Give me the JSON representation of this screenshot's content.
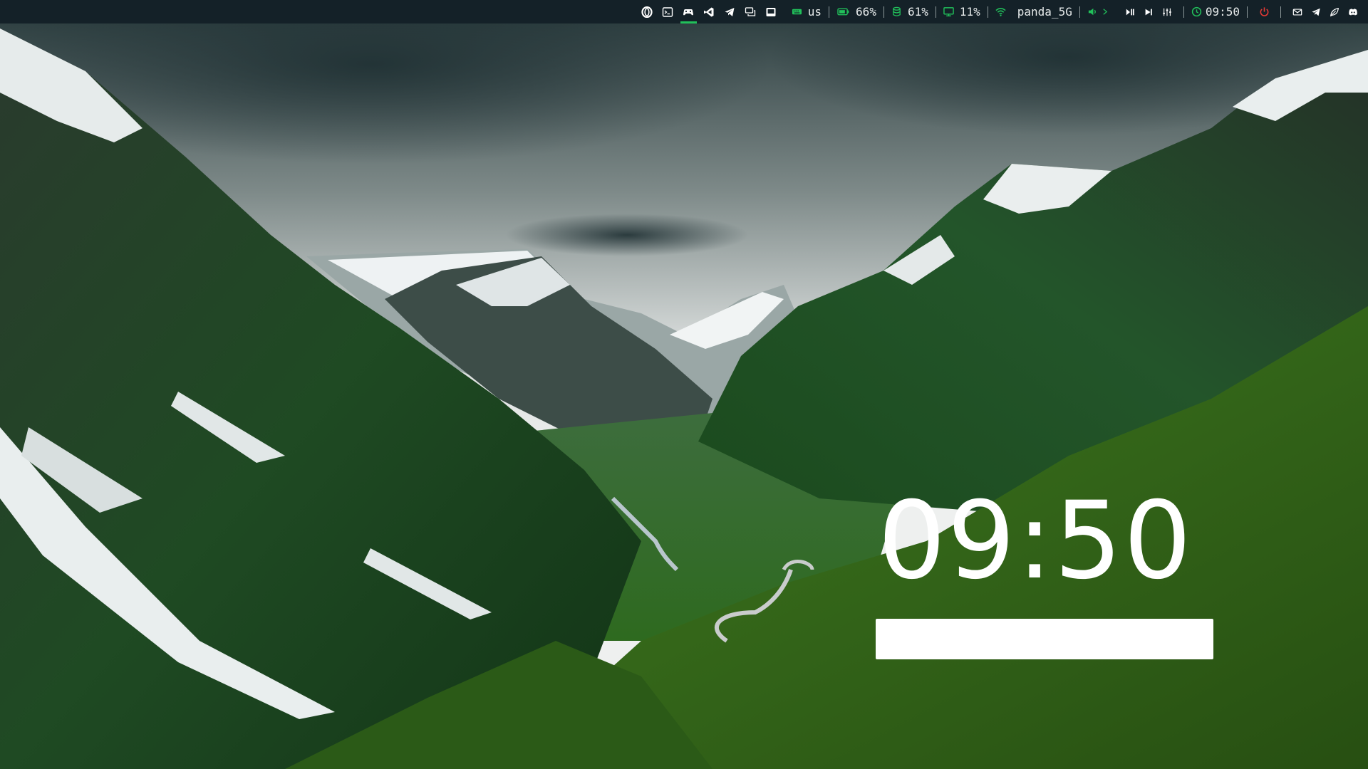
{
  "topbar": {
    "workspaces": [
      {
        "icon": "opera-icon",
        "active": false
      },
      {
        "icon": "terminal-icon",
        "active": false
      },
      {
        "icon": "gamepad-icon",
        "active": true
      },
      {
        "icon": "vscode-icon",
        "active": false
      },
      {
        "icon": "telegram-icon",
        "active": false
      },
      {
        "icon": "chat-icon",
        "active": false
      },
      {
        "icon": "window-icon",
        "active": false
      }
    ],
    "keyboard_layout": "us",
    "battery": "66%",
    "disk": "61%",
    "cpu": "11%",
    "wifi_ssid": "panda_5G",
    "clock": "09:50",
    "tray_icons": [
      "mail-icon",
      "telegram-tray-icon",
      "leaf-icon",
      "discord-icon"
    ],
    "accent_color": "#21c05a",
    "power_color": "#e53935"
  },
  "lock_screen": {
    "time": "09:50",
    "password_value": ""
  }
}
